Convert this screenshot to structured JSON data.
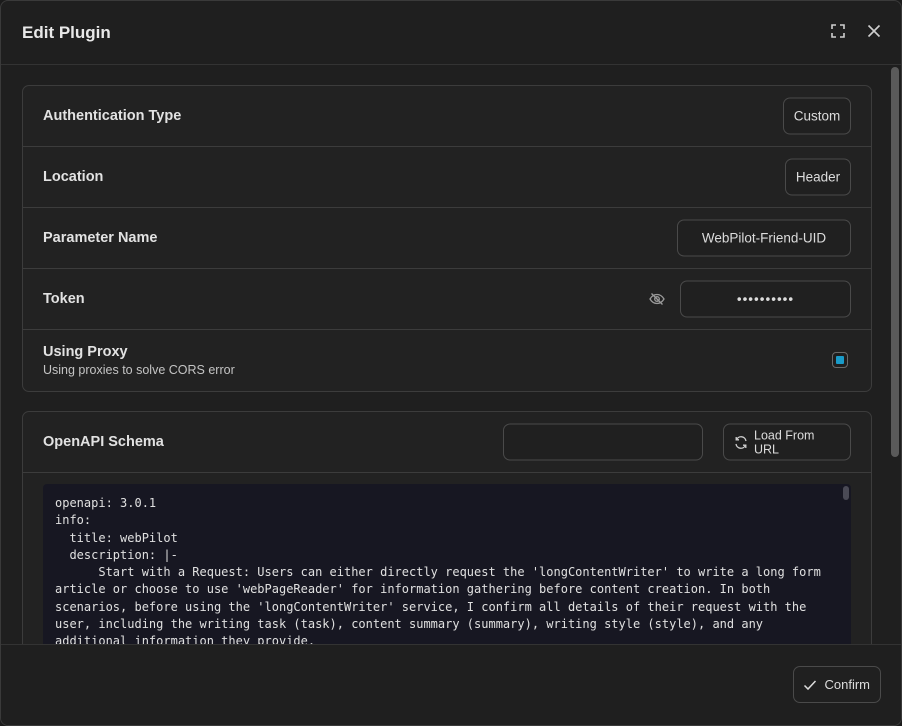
{
  "dialog": {
    "title": "Edit Plugin"
  },
  "auth_card": {
    "authentication_type": {
      "label": "Authentication Type",
      "value": "Custom"
    },
    "location": {
      "label": "Location",
      "value": "Header"
    },
    "parameter_name": {
      "label": "Parameter Name",
      "value": "WebPilot-Friend-UID"
    },
    "token": {
      "label": "Token",
      "value": "••••••••••"
    },
    "proxy": {
      "label": "Using Proxy",
      "description": "Using proxies to solve CORS error",
      "checked": true
    }
  },
  "schema_card": {
    "label": "OpenAPI Schema",
    "url_input": {
      "value": "",
      "placeholder": ""
    },
    "load_button_label": "Load From URL",
    "code_lines": [
      "openapi: 3.0.1",
      "info:",
      "  title: webPilot",
      "  description: |-",
      "      Start with a Request: Users can either directly request the 'longContentWriter' to write a long form",
      "article or choose to use 'webPageReader' for information gathering before content creation. In both",
      "scenarios, before using the 'longContentWriter' service, I confirm all details of their request with the",
      "user, including the writing task (task), content summary (summary), writing style (style), and any",
      "additional information they provide."
    ]
  },
  "footer": {
    "confirm_label": "Confirm"
  },
  "colors": {
    "background": "#1f1f1f",
    "code_background": "#171722",
    "accent": "#1a9bc9"
  },
  "icons": [
    "expand-icon",
    "close-icon",
    "eye-off-icon",
    "refresh-icon",
    "check-icon"
  ]
}
